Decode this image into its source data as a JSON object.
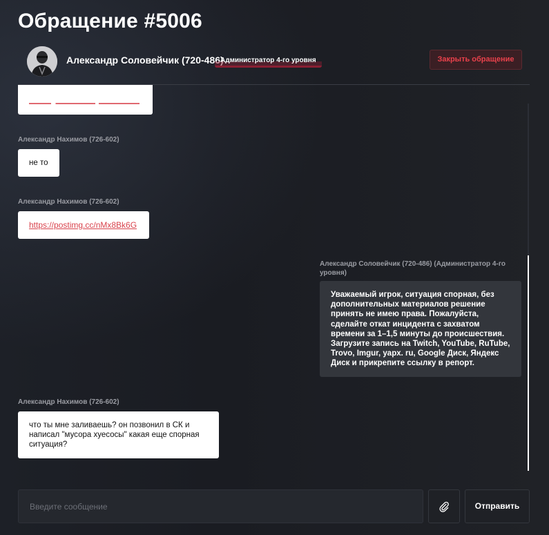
{
  "page": {
    "title": "Обращение #5006"
  },
  "header": {
    "user_name": "Александр Соловейчик (720-486)",
    "role_badge": "Администратор 4-го уровня",
    "close_button": "Закрыть обращение"
  },
  "messages": [
    {
      "author": "Александр Нахимов (726-602)",
      "text": "не то"
    },
    {
      "author": "Александр Нахимов (726-602)",
      "link": "https://postimg.cc/nMx8Bk6G"
    },
    {
      "author": "Александр Соловейчик (720-486) (Администратор 4-го уровня)",
      "text": "Уважаемый игрок, ситуация спорная, без дополнительных материалов решение принять не имею права. Пожалуйста, сделайте откат инцидента с захватом времени за 1–1,5 минуты до происшествия. Загрузите запись на Twitch, YouTube, RuTube, Trovo, Imgur, yapx. ru, Google Диск, Яндекс Диск и прикрепите ссылку в репорт."
    },
    {
      "author": "Александр Нахимов (726-602)",
      "text": "что ты мне заливаешь? он позвонил в СК и написал \"мусора хуесосы\" какая еще спорная ситуация?"
    }
  ],
  "composer": {
    "placeholder": "Введите сообщение",
    "send_button": "Отправить",
    "attach_icon": "paperclip-icon"
  },
  "colors": {
    "accent_red": "#e8414b",
    "link_red": "#d9434d",
    "background": "#1a1c22",
    "admin_bubble": "#33363c"
  }
}
